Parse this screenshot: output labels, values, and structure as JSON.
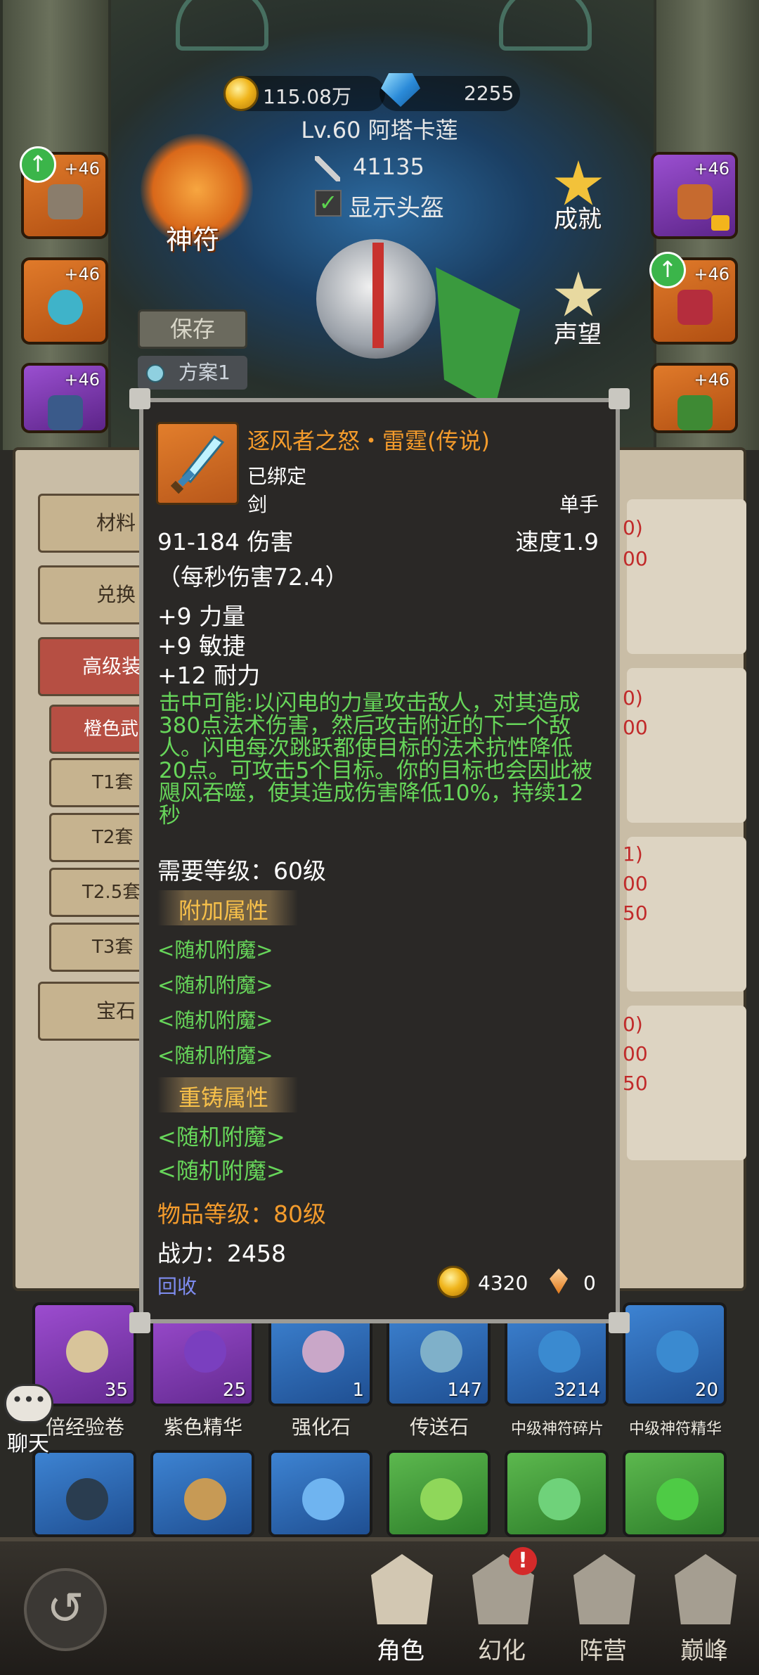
{
  "currency": {
    "gold": "115.08万",
    "gems": "2255"
  },
  "character": {
    "title": "Lv.60 阿塔卡莲",
    "power": "41135",
    "show_helmet_label": "显示头盔",
    "show_helmet_checked": true
  },
  "left_buttons": {
    "rune": "神符",
    "save": "保存",
    "plan": "方案1"
  },
  "right_buttons": {
    "achievements": "成就",
    "reputation": "声望"
  },
  "equip_slots": [
    {
      "level": "+46",
      "color": "orange",
      "upgrade": true
    },
    {
      "level": "+46",
      "color": "orange",
      "upgrade": false
    },
    {
      "level": "+46",
      "color": "purple",
      "upgrade": false
    },
    {
      "level": "+46",
      "color": "purple",
      "locked": true
    },
    {
      "level": "+46",
      "color": "orange",
      "upgrade": true
    },
    {
      "level": "+46",
      "color": "orange",
      "upgrade": false
    }
  ],
  "side_tabs": [
    "材料",
    "兑换",
    "高级装",
    "橙色武",
    "T1套",
    "T2套",
    "T2.5套",
    "T3套",
    "宝石"
  ],
  "behind_numbers": [
    "0)",
    "00",
    "0)",
    "00",
    "1)",
    "00",
    "50",
    "0)",
    "00",
    "50"
  ],
  "tooltip": {
    "name": "逐风者之怒・雷霆(传说)",
    "bound": "已绑定",
    "type": "剑",
    "hand": "单手",
    "damage": "91-184 伤害",
    "speed": "速度1.9",
    "dps": "（每秒伤害72.4）",
    "stats": [
      "+9 力量",
      "+9 敏捷",
      "+12 耐力"
    ],
    "proc": "击中可能:以闪电的力量攻击敌人，对其造成380点法术伤害，然后攻击附近的下一个敌人。闪电每次跳跃都使目标的法术抗性降低20点。可攻击5个目标。你的目标也会因此被飓风吞噬，使其造成伤害降低10%，持续12秒",
    "required_level": "需要等级：60级",
    "extra_header": "附加属性",
    "extra_attrs": [
      "<随机附魔>",
      "<随机附魔>",
      "<随机附魔>",
      "<随机附魔>"
    ],
    "reforge_header": "重铸属性",
    "reforge_attrs": [
      "<随机附魔>",
      "<随机附魔>"
    ],
    "item_level": "物品等级：80级",
    "power": "战力：2458",
    "recycle": "回收",
    "sell_gold": "4320",
    "sell_crystal": "0"
  },
  "bag": [
    {
      "label": "倍经验卷",
      "count": "35",
      "color": "purple"
    },
    {
      "label": "紫色精华",
      "count": "25",
      "color": "purple"
    },
    {
      "label": "强化石",
      "count": "1",
      "color": "blue"
    },
    {
      "label": "传送石",
      "count": "147",
      "color": "blue"
    },
    {
      "label": "中级神符碎片",
      "count": "3214",
      "color": "blue"
    },
    {
      "label": "中级神符精华",
      "count": "20",
      "color": "blue"
    }
  ],
  "chat_label": "聊天",
  "nav": [
    {
      "label": "角色",
      "active": true
    },
    {
      "label": "幻化",
      "badge": "!"
    },
    {
      "label": "阵营"
    },
    {
      "label": "巅峰"
    }
  ]
}
